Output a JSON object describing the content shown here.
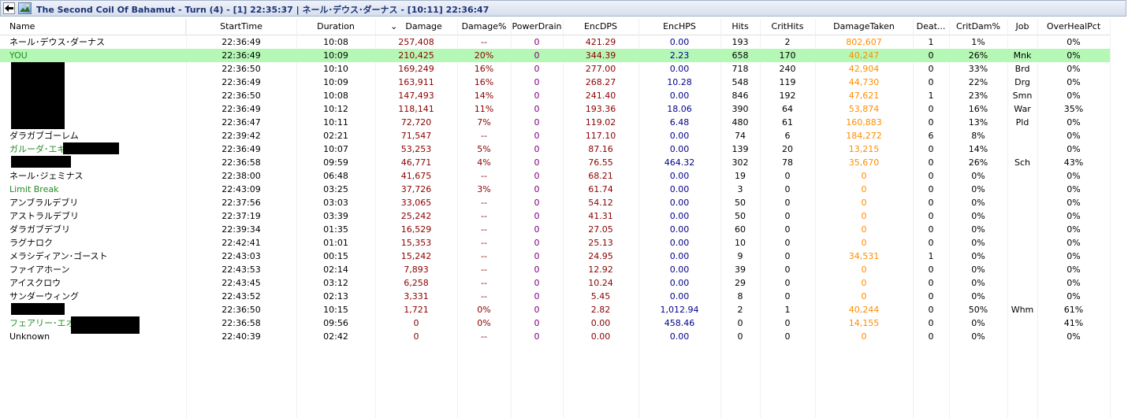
{
  "window": {
    "title": "The Second Coil Of Bahamut - Turn (4) - [1] 22:35:37 | ネール･デウス･ダーナス - [10:11] 22:36:47"
  },
  "colors": {
    "you_row": "#b5f7b5",
    "damage": "#8b0000",
    "powerdrain": "#800080",
    "encdps": "#8b0000",
    "enchps": "#00008b",
    "damagetaken": "#ff8c00",
    "green_name": "#228b22"
  },
  "columns": [
    "Name",
    "StartTime",
    "Duration",
    "Damage",
    "Damage%",
    "PowerDrain",
    "EncDPS",
    "EncHPS",
    "Hits",
    "CritHits",
    "DamageTaken",
    "Deat...",
    "CritDam%",
    "Job",
    "OverHealPct"
  ],
  "sort_indicator": "⌄",
  "rows": [
    {
      "name": "ネール･デウス･ダーナス",
      "start": "22:36:49",
      "duration": "10:08",
      "damage": "257,408",
      "pct": "--",
      "drain": "0",
      "dps": "421.29",
      "hps": "0.00",
      "hits": "193",
      "crit": "2",
      "taken": "802,607",
      "deaths": "1",
      "critdam": "1%",
      "job": "",
      "overheal": "0%",
      "name_color": "#000000"
    },
    {
      "name": "YOU",
      "start": "22:36:49",
      "duration": "10:09",
      "damage": "210,425",
      "pct": "20%",
      "drain": "0",
      "dps": "344.39",
      "hps": "2.23",
      "hits": "658",
      "crit": "170",
      "taken": "40,247",
      "deaths": "0",
      "critdam": "26%",
      "job": "Mnk",
      "overheal": "0%",
      "name_color": "#228b22",
      "highlight": true
    },
    {
      "name": "",
      "start": "22:36:50",
      "duration": "10:10",
      "damage": "169,249",
      "pct": "16%",
      "drain": "0",
      "dps": "277.00",
      "hps": "0.00",
      "hits": "718",
      "crit": "240",
      "taken": "42,904",
      "deaths": "0",
      "critdam": "33%",
      "job": "Brd",
      "overheal": "0%",
      "name_color": "#000000"
    },
    {
      "name": "",
      "start": "22:36:49",
      "duration": "10:09",
      "damage": "163,911",
      "pct": "16%",
      "drain": "0",
      "dps": "268.27",
      "hps": "10.28",
      "hits": "548",
      "crit": "119",
      "taken": "44,730",
      "deaths": "0",
      "critdam": "22%",
      "job": "Drg",
      "overheal": "0%",
      "name_color": "#000000"
    },
    {
      "name": "",
      "start": "22:36:50",
      "duration": "10:08",
      "damage": "147,493",
      "pct": "14%",
      "drain": "0",
      "dps": "241.40",
      "hps": "0.00",
      "hits": "846",
      "crit": "192",
      "taken": "47,621",
      "deaths": "1",
      "critdam": "23%",
      "job": "Smn",
      "overheal": "0%",
      "name_color": "#000000"
    },
    {
      "name": "",
      "start": "22:36:49",
      "duration": "10:12",
      "damage": "118,141",
      "pct": "11%",
      "drain": "0",
      "dps": "193.36",
      "hps": "18.06",
      "hits": "390",
      "crit": "64",
      "taken": "53,874",
      "deaths": "0",
      "critdam": "16%",
      "job": "War",
      "overheal": "35%",
      "name_color": "#000000"
    },
    {
      "name": "",
      "start": "22:36:47",
      "duration": "10:11",
      "damage": "72,720",
      "pct": "7%",
      "drain": "0",
      "dps": "119.02",
      "hps": "6.48",
      "hits": "480",
      "crit": "61",
      "taken": "160,883",
      "deaths": "0",
      "critdam": "13%",
      "job": "Pld",
      "overheal": "0%",
      "name_color": "#000000"
    },
    {
      "name": "ダラガブゴーレム",
      "start": "22:39:42",
      "duration": "02:21",
      "damage": "71,547",
      "pct": "--",
      "drain": "0",
      "dps": "117.10",
      "hps": "0.00",
      "hits": "74",
      "crit": "6",
      "taken": "184,272",
      "deaths": "6",
      "critdam": "8%",
      "job": "",
      "overheal": "0%",
      "name_color": "#000000"
    },
    {
      "name": "ガルーダ･エギ",
      "start": "22:36:49",
      "duration": "10:07",
      "damage": "53,253",
      "pct": "5%",
      "drain": "0",
      "dps": "87.16",
      "hps": "0.00",
      "hits": "139",
      "crit": "20",
      "taken": "13,215",
      "deaths": "0",
      "critdam": "14%",
      "job": "",
      "overheal": "0%",
      "name_color": "#228b22"
    },
    {
      "name": "",
      "start": "22:36:58",
      "duration": "09:59",
      "damage": "46,771",
      "pct": "4%",
      "drain": "0",
      "dps": "76.55",
      "hps": "464.32",
      "hits": "302",
      "crit": "78",
      "taken": "35,670",
      "deaths": "0",
      "critdam": "26%",
      "job": "Sch",
      "overheal": "43%",
      "name_color": "#000000"
    },
    {
      "name": "ネール･ジェミナス",
      "start": "22:38:00",
      "duration": "06:48",
      "damage": "41,675",
      "pct": "--",
      "drain": "0",
      "dps": "68.21",
      "hps": "0.00",
      "hits": "19",
      "crit": "0",
      "taken": "0",
      "deaths": "0",
      "critdam": "0%",
      "job": "",
      "overheal": "0%",
      "name_color": "#000000"
    },
    {
      "name": "Limit Break",
      "start": "22:43:09",
      "duration": "03:25",
      "damage": "37,726",
      "pct": "3%",
      "drain": "0",
      "dps": "61.74",
      "hps": "0.00",
      "hits": "3",
      "crit": "0",
      "taken": "0",
      "deaths": "0",
      "critdam": "0%",
      "job": "",
      "overheal": "0%",
      "name_color": "#228b22"
    },
    {
      "name": "アンブラルデブリ",
      "start": "22:37:56",
      "duration": "03:03",
      "damage": "33,065",
      "pct": "--",
      "drain": "0",
      "dps": "54.12",
      "hps": "0.00",
      "hits": "50",
      "crit": "0",
      "taken": "0",
      "deaths": "0",
      "critdam": "0%",
      "job": "",
      "overheal": "0%",
      "name_color": "#000000"
    },
    {
      "name": "アストラルデブリ",
      "start": "22:37:19",
      "duration": "03:39",
      "damage": "25,242",
      "pct": "--",
      "drain": "0",
      "dps": "41.31",
      "hps": "0.00",
      "hits": "50",
      "crit": "0",
      "taken": "0",
      "deaths": "0",
      "critdam": "0%",
      "job": "",
      "overheal": "0%",
      "name_color": "#000000"
    },
    {
      "name": "ダラガブデブリ",
      "start": "22:39:34",
      "duration": "01:35",
      "damage": "16,529",
      "pct": "--",
      "drain": "0",
      "dps": "27.05",
      "hps": "0.00",
      "hits": "60",
      "crit": "0",
      "taken": "0",
      "deaths": "0",
      "critdam": "0%",
      "job": "",
      "overheal": "0%",
      "name_color": "#000000"
    },
    {
      "name": "ラグナロク",
      "start": "22:42:41",
      "duration": "01:01",
      "damage": "15,353",
      "pct": "--",
      "drain": "0",
      "dps": "25.13",
      "hps": "0.00",
      "hits": "10",
      "crit": "0",
      "taken": "0",
      "deaths": "0",
      "critdam": "0%",
      "job": "",
      "overheal": "0%",
      "name_color": "#000000"
    },
    {
      "name": "メラシディアン･ゴースト",
      "start": "22:43:03",
      "duration": "00:15",
      "damage": "15,242",
      "pct": "--",
      "drain": "0",
      "dps": "24.95",
      "hps": "0.00",
      "hits": "9",
      "crit": "0",
      "taken": "34,531",
      "deaths": "1",
      "critdam": "0%",
      "job": "",
      "overheal": "0%",
      "name_color": "#000000"
    },
    {
      "name": "ファイアホーン",
      "start": "22:43:53",
      "duration": "02:14",
      "damage": "7,893",
      "pct": "--",
      "drain": "0",
      "dps": "12.92",
      "hps": "0.00",
      "hits": "39",
      "crit": "0",
      "taken": "0",
      "deaths": "0",
      "critdam": "0%",
      "job": "",
      "overheal": "0%",
      "name_color": "#000000"
    },
    {
      "name": "アイスクロウ",
      "start": "22:43:45",
      "duration": "03:12",
      "damage": "6,258",
      "pct": "--",
      "drain": "0",
      "dps": "10.24",
      "hps": "0.00",
      "hits": "29",
      "crit": "0",
      "taken": "0",
      "deaths": "0",
      "critdam": "0%",
      "job": "",
      "overheal": "0%",
      "name_color": "#000000"
    },
    {
      "name": "サンダーウィング",
      "start": "22:43:52",
      "duration": "02:13",
      "damage": "3,331",
      "pct": "--",
      "drain": "0",
      "dps": "5.45",
      "hps": "0.00",
      "hits": "8",
      "crit": "0",
      "taken": "0",
      "deaths": "0",
      "critdam": "0%",
      "job": "",
      "overheal": "0%",
      "name_color": "#000000"
    },
    {
      "name": "",
      "start": "22:36:50",
      "duration": "10:15",
      "damage": "1,721",
      "pct": "0%",
      "drain": "0",
      "dps": "2.82",
      "hps": "1,012.94",
      "hits": "2",
      "crit": "1",
      "taken": "40,244",
      "deaths": "0",
      "critdam": "50%",
      "job": "Whm",
      "overheal": "61%",
      "name_color": "#000000"
    },
    {
      "name": "フェアリー･エオス",
      "start": "22:36:58",
      "duration": "09:56",
      "damage": "0",
      "pct": "0%",
      "drain": "0",
      "dps": "0.00",
      "hps": "458.46",
      "hits": "0",
      "crit": "0",
      "taken": "14,155",
      "deaths": "0",
      "critdam": "0%",
      "job": "",
      "overheal": "41%",
      "name_color": "#228b22"
    },
    {
      "name": "Unknown",
      "start": "22:40:39",
      "duration": "02:42",
      "damage": "0",
      "pct": "--",
      "drain": "0",
      "dps": "0.00",
      "hps": "0.00",
      "hits": "0",
      "crit": "0",
      "taken": "0",
      "deaths": "0",
      "critdam": "0%",
      "job": "",
      "overheal": "0%",
      "name_color": "#000000"
    }
  ]
}
